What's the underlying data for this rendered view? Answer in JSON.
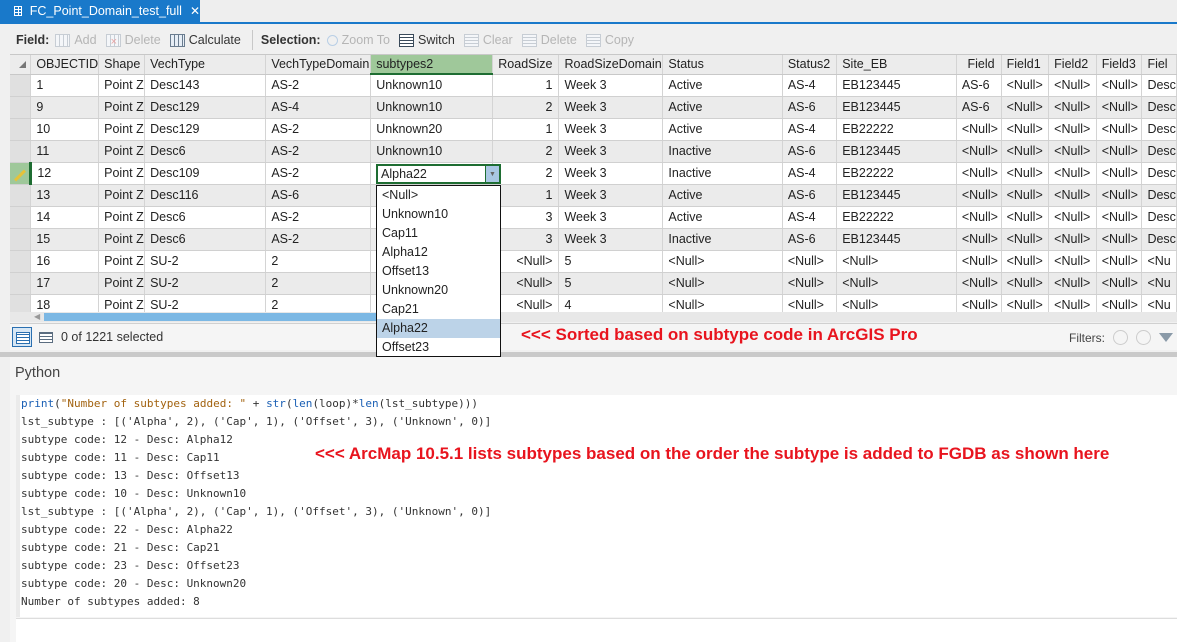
{
  "tab": {
    "title": "FC_Point_Domain_test_full",
    "icon": "table-icon",
    "close": "✕"
  },
  "toolbar": {
    "field_label": "Field:",
    "field_buttons": [
      {
        "label": "Add",
        "icon": "add-field-icon",
        "enabled": false
      },
      {
        "label": "Delete",
        "icon": "delete-field-icon",
        "enabled": false
      },
      {
        "label": "Calculate",
        "icon": "calculate-field-icon",
        "enabled": true
      }
    ],
    "selection_label": "Selection:",
    "selection_buttons": [
      {
        "label": "Zoom To",
        "icon": "zoom-to-icon",
        "enabled": false
      },
      {
        "label": "Switch",
        "icon": "switch-selection-icon",
        "enabled": true
      },
      {
        "label": "Clear",
        "icon": "clear-selection-icon",
        "enabled": false
      },
      {
        "label": "Delete",
        "icon": "delete-selection-icon",
        "enabled": false
      },
      {
        "label": "Copy",
        "icon": "copy-icon",
        "enabled": false
      }
    ]
  },
  "table": {
    "columns": [
      "OBJECTID",
      "Shape",
      "VechType",
      "VechTypeDomain",
      "subtypes2",
      "RoadSize",
      "RoadSizeDomain",
      "Status",
      "Status2",
      "Site_EB",
      "Field",
      "Field1",
      "Field2",
      "Field3",
      "Fiel"
    ],
    "selected_column": "subtypes2",
    "rows": [
      [
        "1",
        "Point Z",
        "Desc143",
        "AS-2",
        "Unknown10",
        "1",
        "Week 3",
        "Active",
        "AS-4",
        "EB123445",
        "AS-6",
        "<Null>",
        "<Null>",
        "<Null>",
        "Desc"
      ],
      [
        "9",
        "Point Z",
        "Desc129",
        "AS-4",
        "Unknown10",
        "2",
        "Week 3",
        "Active",
        "AS-6",
        "EB123445",
        "AS-6",
        "<Null>",
        "<Null>",
        "<Null>",
        "Desc"
      ],
      [
        "10",
        "Point Z",
        "Desc129",
        "AS-2",
        "Unknown20",
        "1",
        "Week 3",
        "Active",
        "AS-4",
        "EB22222",
        "<Null>",
        "<Null>",
        "<Null>",
        "<Null>",
        "Desc"
      ],
      [
        "11",
        "Point Z",
        "Desc6",
        "AS-2",
        "Unknown10",
        "2",
        "Week 3",
        "Inactive",
        "AS-6",
        "EB123445",
        "<Null>",
        "<Null>",
        "<Null>",
        "<Null>",
        "Desc"
      ],
      [
        "12",
        "Point Z",
        "Desc109",
        "AS-2",
        "Alpha22",
        "2",
        "Week 3",
        "Inactive",
        "AS-4",
        "EB22222",
        "<Null>",
        "<Null>",
        "<Null>",
        "<Null>",
        "Desc"
      ],
      [
        "13",
        "Point Z",
        "Desc116",
        "AS-6",
        "",
        "1",
        "Week 3",
        "Active",
        "AS-6",
        "EB123445",
        "<Null>",
        "<Null>",
        "<Null>",
        "<Null>",
        "Desc"
      ],
      [
        "14",
        "Point Z",
        "Desc6",
        "AS-2",
        "",
        "3",
        "Week 3",
        "Active",
        "AS-4",
        "EB22222",
        "<Null>",
        "<Null>",
        "<Null>",
        "<Null>",
        "Desc"
      ],
      [
        "15",
        "Point Z",
        "Desc6",
        "AS-2",
        "",
        "3",
        "Week 3",
        "Inactive",
        "AS-6",
        "EB123445",
        "<Null>",
        "<Null>",
        "<Null>",
        "<Null>",
        "Desc"
      ],
      [
        "16",
        "Point Z",
        "SU-2",
        "2",
        "",
        "<Null>",
        "5",
        "<Null>",
        "<Null>",
        "<Null>",
        "<Null>",
        "<Null>",
        "<Null>",
        "<Null>",
        "<Nu"
      ],
      [
        "17",
        "Point Z",
        "SU-2",
        "2",
        "",
        "<Null>",
        "5",
        "<Null>",
        "<Null>",
        "<Null>",
        "<Null>",
        "<Null>",
        "<Null>",
        "<Null>",
        "<Nu"
      ],
      [
        "18",
        "Point Z",
        "SU-2",
        "2",
        "",
        "<Null>",
        "4",
        "<Null>",
        "<Null>",
        "<Null>",
        "<Null>",
        "<Null>",
        "<Null>",
        "<Null>",
        "<Nu"
      ]
    ],
    "editing_row_index": 4
  },
  "editor": {
    "value": "Alpha22",
    "options": [
      "<Null>",
      "Unknown10",
      "Cap11",
      "Alpha12",
      "Offset13",
      "Unknown20",
      "Cap21",
      "Alpha22",
      "Offset23"
    ],
    "selected": "Alpha22"
  },
  "status": {
    "selected_text": "0 of 1221 selected",
    "filters_label": "Filters:"
  },
  "annotations": {
    "pro": "<<< Sorted based on subtype code in ArcGIS Pro",
    "arcmap": "<<< ArcMap 10.5.1 lists subtypes based on the order the subtype is added to FGDB as shown here"
  },
  "python": {
    "title": "Python",
    "command": "print(\"Number of subtypes added: \" + str(len(loop)*len(lst_subtype)))",
    "output": [
      "lst_subtype : [('Alpha', 2), ('Cap', 1), ('Offset', 3), ('Unknown', 0)]",
      "subtype code: 12 - Desc: Alpha12",
      "subtype code: 11 - Desc: Cap11",
      "subtype code: 13 - Desc: Offset13",
      "subtype code: 10 - Desc: Unknown10",
      "lst_subtype : [('Alpha', 2), ('Cap', 1), ('Offset', 3), ('Unknown', 0)]",
      "subtype code: 22 - Desc: Alpha22",
      "subtype code: 21 - Desc: Cap21",
      "subtype code: 23 - Desc: Offset23",
      "subtype code: 20 - Desc: Unknown20",
      "Number of subtypes added: 8"
    ]
  }
}
